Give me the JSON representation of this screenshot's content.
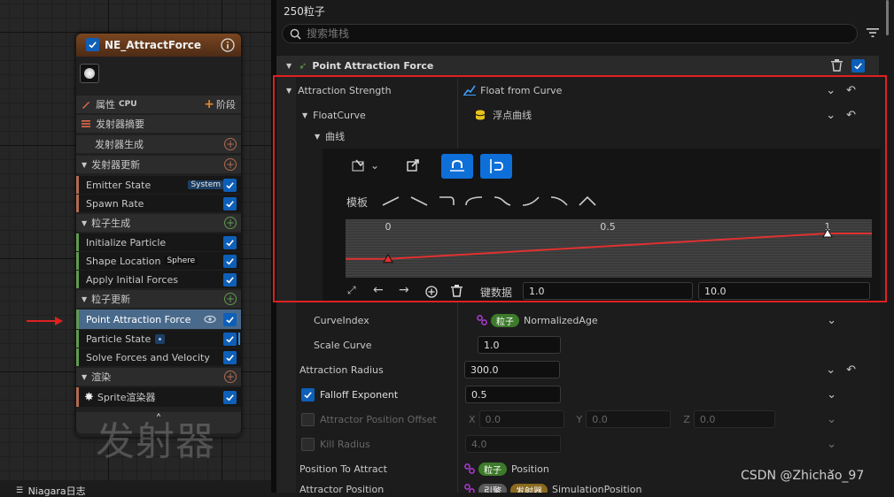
{
  "emitter_node": {
    "title": "NE_AttractForce",
    "properties_label": "属性",
    "cpu_label": "CPU",
    "stage_label": "阶段",
    "summary_label": "发射器摘要",
    "sections": [
      {
        "label": "发射器生成",
        "kind": "sub"
      },
      {
        "label": "发射器更新",
        "kind": "section",
        "color": "#b26a4f"
      },
      {
        "label": "粒子生成",
        "kind": "section",
        "color": "#5f9a4e"
      },
      {
        "label": "粒子更新",
        "kind": "section",
        "color": "#5f9a4e"
      },
      {
        "label": "渲染",
        "kind": "section",
        "color": "#b26a4f"
      }
    ],
    "modules": {
      "emitter_state": "Emitter State",
      "emitter_state_tag": "System",
      "spawn_rate": "Spawn Rate",
      "initialize_particle": "Initialize Particle",
      "shape_location": "Shape Location",
      "shape_location_tag": "Sphere",
      "apply_initial_forces": "Apply Initial Forces",
      "point_attraction_force": "Point Attraction Force",
      "particle_state": "Particle State",
      "solve_forces": "Solve Forces and Velocity",
      "sprite_renderer": "Sprite渲染器"
    },
    "watermark": "发射器"
  },
  "bottom_left_tab": "Niagara日志",
  "panel": {
    "particle_count": "250粒子",
    "search_placeholder": "搜索堆栈",
    "module_header": "Point Attraction Force",
    "attraction_strength_label": "Attraction Strength",
    "attraction_strength_value": "Float from Curve",
    "float_curve_label": "FloatCurve",
    "float_curve_value": "浮点曲线",
    "curve_label": "曲线",
    "template_label": "模板",
    "curve": {
      "x_ticks": [
        "0",
        "0.5",
        "1"
      ],
      "keys": [
        {
          "x": 0,
          "y": 1.0
        },
        {
          "x": 1,
          "y": 10.0
        }
      ],
      "line_color": "#e03131"
    },
    "key_data_label": "键数据",
    "key_time": "1.0",
    "key_value": "10.0",
    "curve_index_label": "CurveIndex",
    "curve_index_pill": "粒子",
    "curve_index_value": "NormalizedAge",
    "scale_curve_label": "Scale Curve",
    "scale_curve_value": "1.0",
    "attraction_radius_label": "Attraction Radius",
    "attraction_radius_value": "300.0",
    "falloff_exponent_label": "Falloff Exponent",
    "falloff_exponent_value": "0.5",
    "attractor_offset_label": "Attractor Position Offset",
    "offset_x_label": "X",
    "offset_x": "0.0",
    "offset_y_label": "Y",
    "offset_y": "0.0",
    "offset_z_label": "Z",
    "offset_z": "0.0",
    "kill_radius_label": "Kill Radius",
    "kill_radius_value": "4.0",
    "position_to_attract_label": "Position To Attract",
    "position_to_attract_pill": "粒子",
    "position_to_attract_value": "Position",
    "attractor_position_label": "Attractor Position",
    "attractor_position_pill1": "引擎",
    "attractor_position_pill2": "发射器",
    "attractor_position_value": "SimulationPosition"
  },
  "watermark_csdn": "CSDN @Zhichao_97",
  "highlight_color": "#e02020",
  "accent_color": "#0e5fb8"
}
